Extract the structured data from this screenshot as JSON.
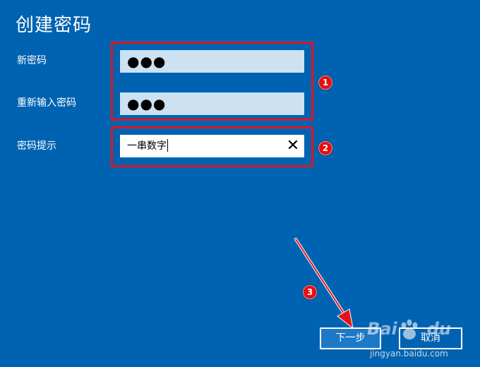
{
  "page": {
    "title": "创建密码"
  },
  "fields": {
    "new_password": {
      "label": "新密码",
      "value": "●●●"
    },
    "confirm_password": {
      "label": "重新输入密码",
      "value": "●●●"
    },
    "hint": {
      "label": "密码提示",
      "value": "一串数字",
      "clear_icon": "✕"
    }
  },
  "buttons": {
    "next_label": "下一步",
    "cancel_label": "取消"
  },
  "annotations": {
    "step1": "1",
    "step2": "2",
    "step3": "3"
  },
  "watermark": {
    "brand": "Bai",
    "brand_suffix": "du",
    "domain": "jingyan.baidu.com"
  },
  "colors": {
    "background": "#0063b1",
    "password_field": "#cce1f1",
    "annotation_red": "#e0151b",
    "next_button": "#1e78c8"
  }
}
